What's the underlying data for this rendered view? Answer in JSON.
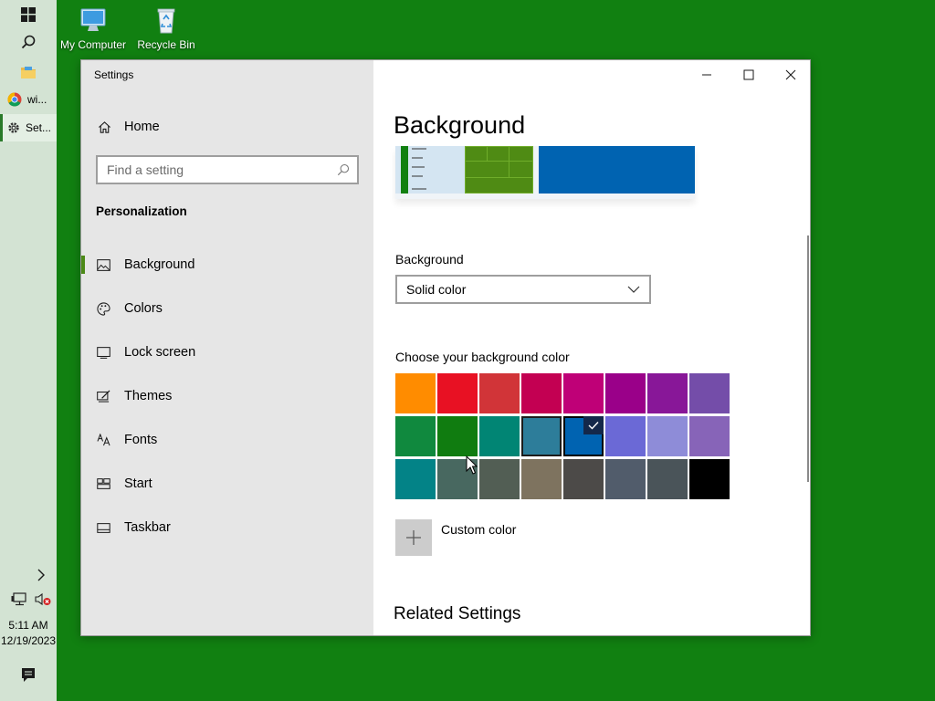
{
  "desktop": {
    "background_color": "#118011",
    "icons": [
      {
        "label": "My Computer",
        "icon": "computer-icon"
      },
      {
        "label": "Recycle Bin",
        "icon": "recycle-bin-icon"
      }
    ]
  },
  "taskbar": {
    "apps": [
      {
        "label": "wi...",
        "icon": "chrome-icon"
      },
      {
        "label": "Set...",
        "icon": "gear-icon"
      }
    ],
    "clock": {
      "time": "5:11 AM",
      "date": "12/19/2023"
    }
  },
  "window": {
    "title": "Settings",
    "nav": {
      "home_label": "Home",
      "search_placeholder": "Find a setting",
      "section": "Personalization",
      "items": [
        {
          "label": "Background",
          "icon": "picture-icon",
          "selected": true
        },
        {
          "label": "Colors",
          "icon": "palette-icon"
        },
        {
          "label": "Lock screen",
          "icon": "lock-screen-icon"
        },
        {
          "label": "Themes",
          "icon": "themes-icon"
        },
        {
          "label": "Fonts",
          "icon": "fonts-icon"
        },
        {
          "label": "Start",
          "icon": "start-icon"
        },
        {
          "label": "Taskbar",
          "icon": "taskbar-icon"
        }
      ]
    },
    "content": {
      "page_title": "Background",
      "background_label": "Background",
      "background_value": "Solid color",
      "choose_label": "Choose your background color",
      "colors": [
        [
          "#ff8c00",
          "#e81123",
          "#d13438",
          "#c30052",
          "#bf0077",
          "#9a0089",
          "#881798",
          "#744da9"
        ],
        [
          "#10893e",
          "#107c10",
          "#018574",
          "#2d7d9a",
          "#0063b1",
          "#6b69d6",
          "#8e8cd8",
          "#8764b8"
        ],
        [
          "#038387",
          "#486860",
          "#525e54",
          "#7e735f",
          "#4c4a48",
          "#515c6b",
          "#4a5459",
          "#000000"
        ]
      ],
      "selected_color": "#0063b1",
      "custom_color_label": "Custom color",
      "related_settings": "Related Settings"
    }
  }
}
